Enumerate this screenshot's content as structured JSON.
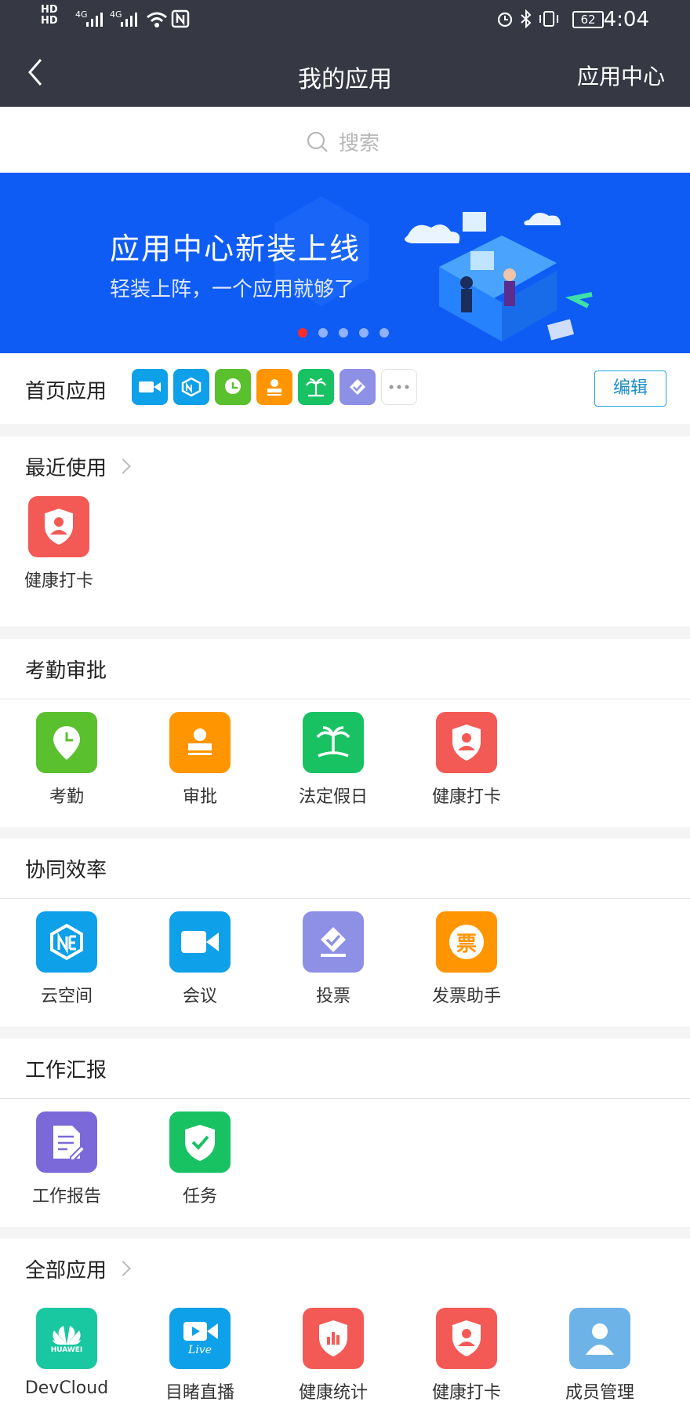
{
  "status": {
    "sig_top": "HD",
    "sig_bottom": "HD",
    "net1": "4G",
    "net2": "4G",
    "battery": "62",
    "time": "4:04"
  },
  "nav": {
    "title": "我的应用",
    "right": "应用中心"
  },
  "search": {
    "placeholder": "搜索"
  },
  "banner": {
    "title": "应用中心新装上线",
    "subtitle": "轻装上阵，一个应用就够了"
  },
  "home": {
    "label": "首页应用",
    "edit": "编辑"
  },
  "recent": {
    "title": "最近使用",
    "apps": [
      {
        "name": "健康打卡"
      }
    ]
  },
  "kaoqin": {
    "title": "考勤审批",
    "apps": [
      {
        "name": "考勤"
      },
      {
        "name": "审批"
      },
      {
        "name": "法定假日"
      },
      {
        "name": "健康打卡"
      }
    ]
  },
  "xietong": {
    "title": "协同效率",
    "apps": [
      {
        "name": "云空间"
      },
      {
        "name": "会议"
      },
      {
        "name": "投票"
      },
      {
        "name": "发票助手"
      }
    ],
    "invoice_glyph": "票"
  },
  "work": {
    "title": "工作汇报",
    "apps": [
      {
        "name": "工作报告"
      },
      {
        "name": "任务"
      }
    ]
  },
  "all": {
    "title": "全部应用",
    "apps": [
      {
        "name": "DevCloud"
      },
      {
        "name": "目睹直播"
      },
      {
        "name": "健康统计"
      },
      {
        "name": "健康打卡"
      },
      {
        "name": "成员管理"
      }
    ],
    "huawei": "HUAWEI",
    "live": "Live"
  },
  "colors": {
    "bar": "#363844",
    "blue": "#0f5cf5",
    "sky": "#0ea0e8",
    "green": "#5ac02e",
    "orange": "#ff9500",
    "teal": "#18c263",
    "lavender": "#8e90e6",
    "red": "#f45a55",
    "purple": "#7c69d9",
    "mint": "#19c7a0",
    "lightblue": "#6db3e8"
  }
}
